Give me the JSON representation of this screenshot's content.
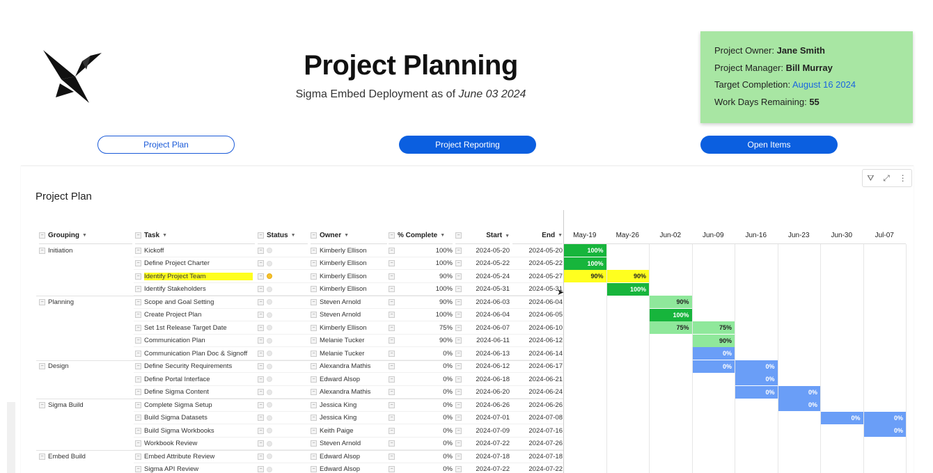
{
  "header": {
    "title": "Project Planning",
    "subtitle_prefix": "Sigma Embed Deployment as of ",
    "subtitle_date": "June 03 2024"
  },
  "info": {
    "owner_label": "Project Owner: ",
    "owner": "Jane Smith",
    "manager_label": "Project Manager: ",
    "manager": "Bill Murray",
    "target_label": "Target Completion: ",
    "target": "August 16 2024",
    "remaining_label": "Work Days Remaining: ",
    "remaining": "55",
    "box_color": "#a8e6a3"
  },
  "nav": {
    "plan": "Project Plan",
    "reporting": "Project Reporting",
    "open": "Open Items"
  },
  "panel": {
    "title": "Project Plan"
  },
  "columns": {
    "grouping": "Grouping",
    "task": "Task",
    "status": "Status",
    "owner": "Owner",
    "complete": "% Complete",
    "start": "Start",
    "end": "End"
  },
  "weeks": [
    "May-19",
    "May-26",
    "Jun-02",
    "Jun-09",
    "Jun-16",
    "Jun-23",
    "Jun-30",
    "Jul-07"
  ],
  "rows": [
    {
      "group": "Initiation",
      "task": "Kickoff",
      "status": "none",
      "owner": "Kimberly Ellison",
      "pct": "100%",
      "start": "2024-05-20",
      "end": "2024-05-20",
      "bars": [
        {
          "w": 0,
          "label": "100%",
          "color": "#17b53c"
        }
      ]
    },
    {
      "group": "",
      "task": "Define Project Charter",
      "status": "none",
      "owner": "Kimberly Ellison",
      "pct": "100%",
      "start": "2024-05-22",
      "end": "2024-05-22",
      "bars": [
        {
          "w": 0,
          "label": "100%",
          "color": "#17b53c"
        }
      ]
    },
    {
      "group": "",
      "task": "Identify Project Team",
      "status": "yellow",
      "owner": "Kimberly Ellison",
      "pct": "90%",
      "start": "2024-05-24",
      "end": "2024-05-27",
      "highlight": true,
      "bars": [
        {
          "w": 0,
          "label": "90%",
          "color": "#ffff1f",
          "dark": true
        },
        {
          "w": 1,
          "label": "90%",
          "color": "#ffff1f",
          "dark": true
        }
      ]
    },
    {
      "group": "",
      "task": "Identify Stakeholders",
      "status": "none",
      "owner": "Kimberly Ellison",
      "pct": "100%",
      "start": "2024-05-31",
      "end": "2024-05-31",
      "bars": [
        {
          "w": 1,
          "label": "100%",
          "color": "#17b53c"
        }
      ]
    },
    {
      "group": "Planning",
      "task": "Scope and Goal Setting",
      "status": "none",
      "owner": "Steven Arnold",
      "pct": "90%",
      "start": "2024-06-03",
      "end": "2024-06-04",
      "bars": [
        {
          "w": 2,
          "label": "90%",
          "color": "#8fe89b",
          "dark": true
        }
      ]
    },
    {
      "group": "",
      "task": "Create Project Plan",
      "status": "none",
      "owner": "Steven Arnold",
      "pct": "100%",
      "start": "2024-06-04",
      "end": "2024-06-05",
      "bars": [
        {
          "w": 2,
          "label": "100%",
          "color": "#17b53c"
        }
      ]
    },
    {
      "group": "",
      "task": "Set 1st Release Target Date",
      "status": "none",
      "owner": "Kimberly Ellison",
      "pct": "75%",
      "start": "2024-06-07",
      "end": "2024-06-10",
      "bars": [
        {
          "w": 2,
          "label": "75%",
          "color": "#8fe89b",
          "dark": true
        },
        {
          "w": 3,
          "label": "75%",
          "color": "#8fe89b",
          "dark": true
        }
      ]
    },
    {
      "group": "",
      "task": "Communication Plan",
      "status": "none",
      "owner": "Melanie Tucker",
      "pct": "90%",
      "start": "2024-06-11",
      "end": "2024-06-12",
      "bars": [
        {
          "w": 3,
          "label": "90%",
          "color": "#8fe89b",
          "dark": true
        }
      ]
    },
    {
      "group": "",
      "task": "Communication Plan Doc & Signoff",
      "status": "none",
      "owner": "Melanie Tucker",
      "pct": "0%",
      "start": "2024-06-13",
      "end": "2024-06-14",
      "bars": [
        {
          "w": 3,
          "label": "0%",
          "color": "#6a9ef7"
        }
      ]
    },
    {
      "group": "Design",
      "task": "Define Security Requirements",
      "status": "none",
      "owner": "Alexandra Mathis",
      "pct": "0%",
      "start": "2024-06-12",
      "end": "2024-06-17",
      "bars": [
        {
          "w": 3,
          "label": "0%",
          "color": "#6a9ef7"
        },
        {
          "w": 4,
          "label": "0%",
          "color": "#6a9ef7"
        }
      ]
    },
    {
      "group": "",
      "task": "Define Portal Interface",
      "status": "none",
      "owner": "Edward Alsop",
      "pct": "0%",
      "start": "2024-06-18",
      "end": "2024-06-21",
      "bars": [
        {
          "w": 4,
          "label": "0%",
          "color": "#6a9ef7"
        }
      ]
    },
    {
      "group": "",
      "task": "Define Sigma Content",
      "status": "none",
      "owner": "Alexandra Mathis",
      "pct": "0%",
      "start": "2024-06-20",
      "end": "2024-06-24",
      "bars": [
        {
          "w": 4,
          "label": "0%",
          "color": "#6a9ef7"
        },
        {
          "w": 5,
          "label": "0%",
          "color": "#6a9ef7"
        }
      ]
    },
    {
      "group": "Sigma Build",
      "task": "Complete Sigma Setup",
      "status": "none",
      "owner": "Jessica King",
      "pct": "0%",
      "start": "2024-06-26",
      "end": "2024-06-26",
      "bars": [
        {
          "w": 5,
          "label": "0%",
          "color": "#6a9ef7"
        }
      ]
    },
    {
      "group": "",
      "task": "Build Sigma Datasets",
      "status": "none",
      "owner": "Jessica King",
      "pct": "0%",
      "start": "2024-07-01",
      "end": "2024-07-08",
      "bars": [
        {
          "w": 6,
          "label": "0%",
          "color": "#6a9ef7"
        },
        {
          "w": 7,
          "label": "0%",
          "color": "#6a9ef7"
        }
      ]
    },
    {
      "group": "",
      "task": "Build Sigma Workbooks",
      "status": "none",
      "owner": "Keith Paige",
      "pct": "0%",
      "start": "2024-07-09",
      "end": "2024-07-16",
      "bars": [
        {
          "w": 7,
          "label": "0%",
          "color": "#6a9ef7"
        }
      ]
    },
    {
      "group": "",
      "task": "Workbook Review",
      "status": "none",
      "owner": "Steven Arnold",
      "pct": "0%",
      "start": "2024-07-22",
      "end": "2024-07-26",
      "bars": []
    },
    {
      "group": "Embed Build",
      "task": "Embed Attribute Review",
      "status": "none",
      "owner": "Edward Alsop",
      "pct": "0%",
      "start": "2024-07-18",
      "end": "2024-07-18",
      "bars": []
    },
    {
      "group": "",
      "task": "Sigma API Review",
      "status": "none",
      "owner": "Edward Alsop",
      "pct": "0%",
      "start": "2024-07-22",
      "end": "2024-07-22",
      "bars": []
    }
  ]
}
